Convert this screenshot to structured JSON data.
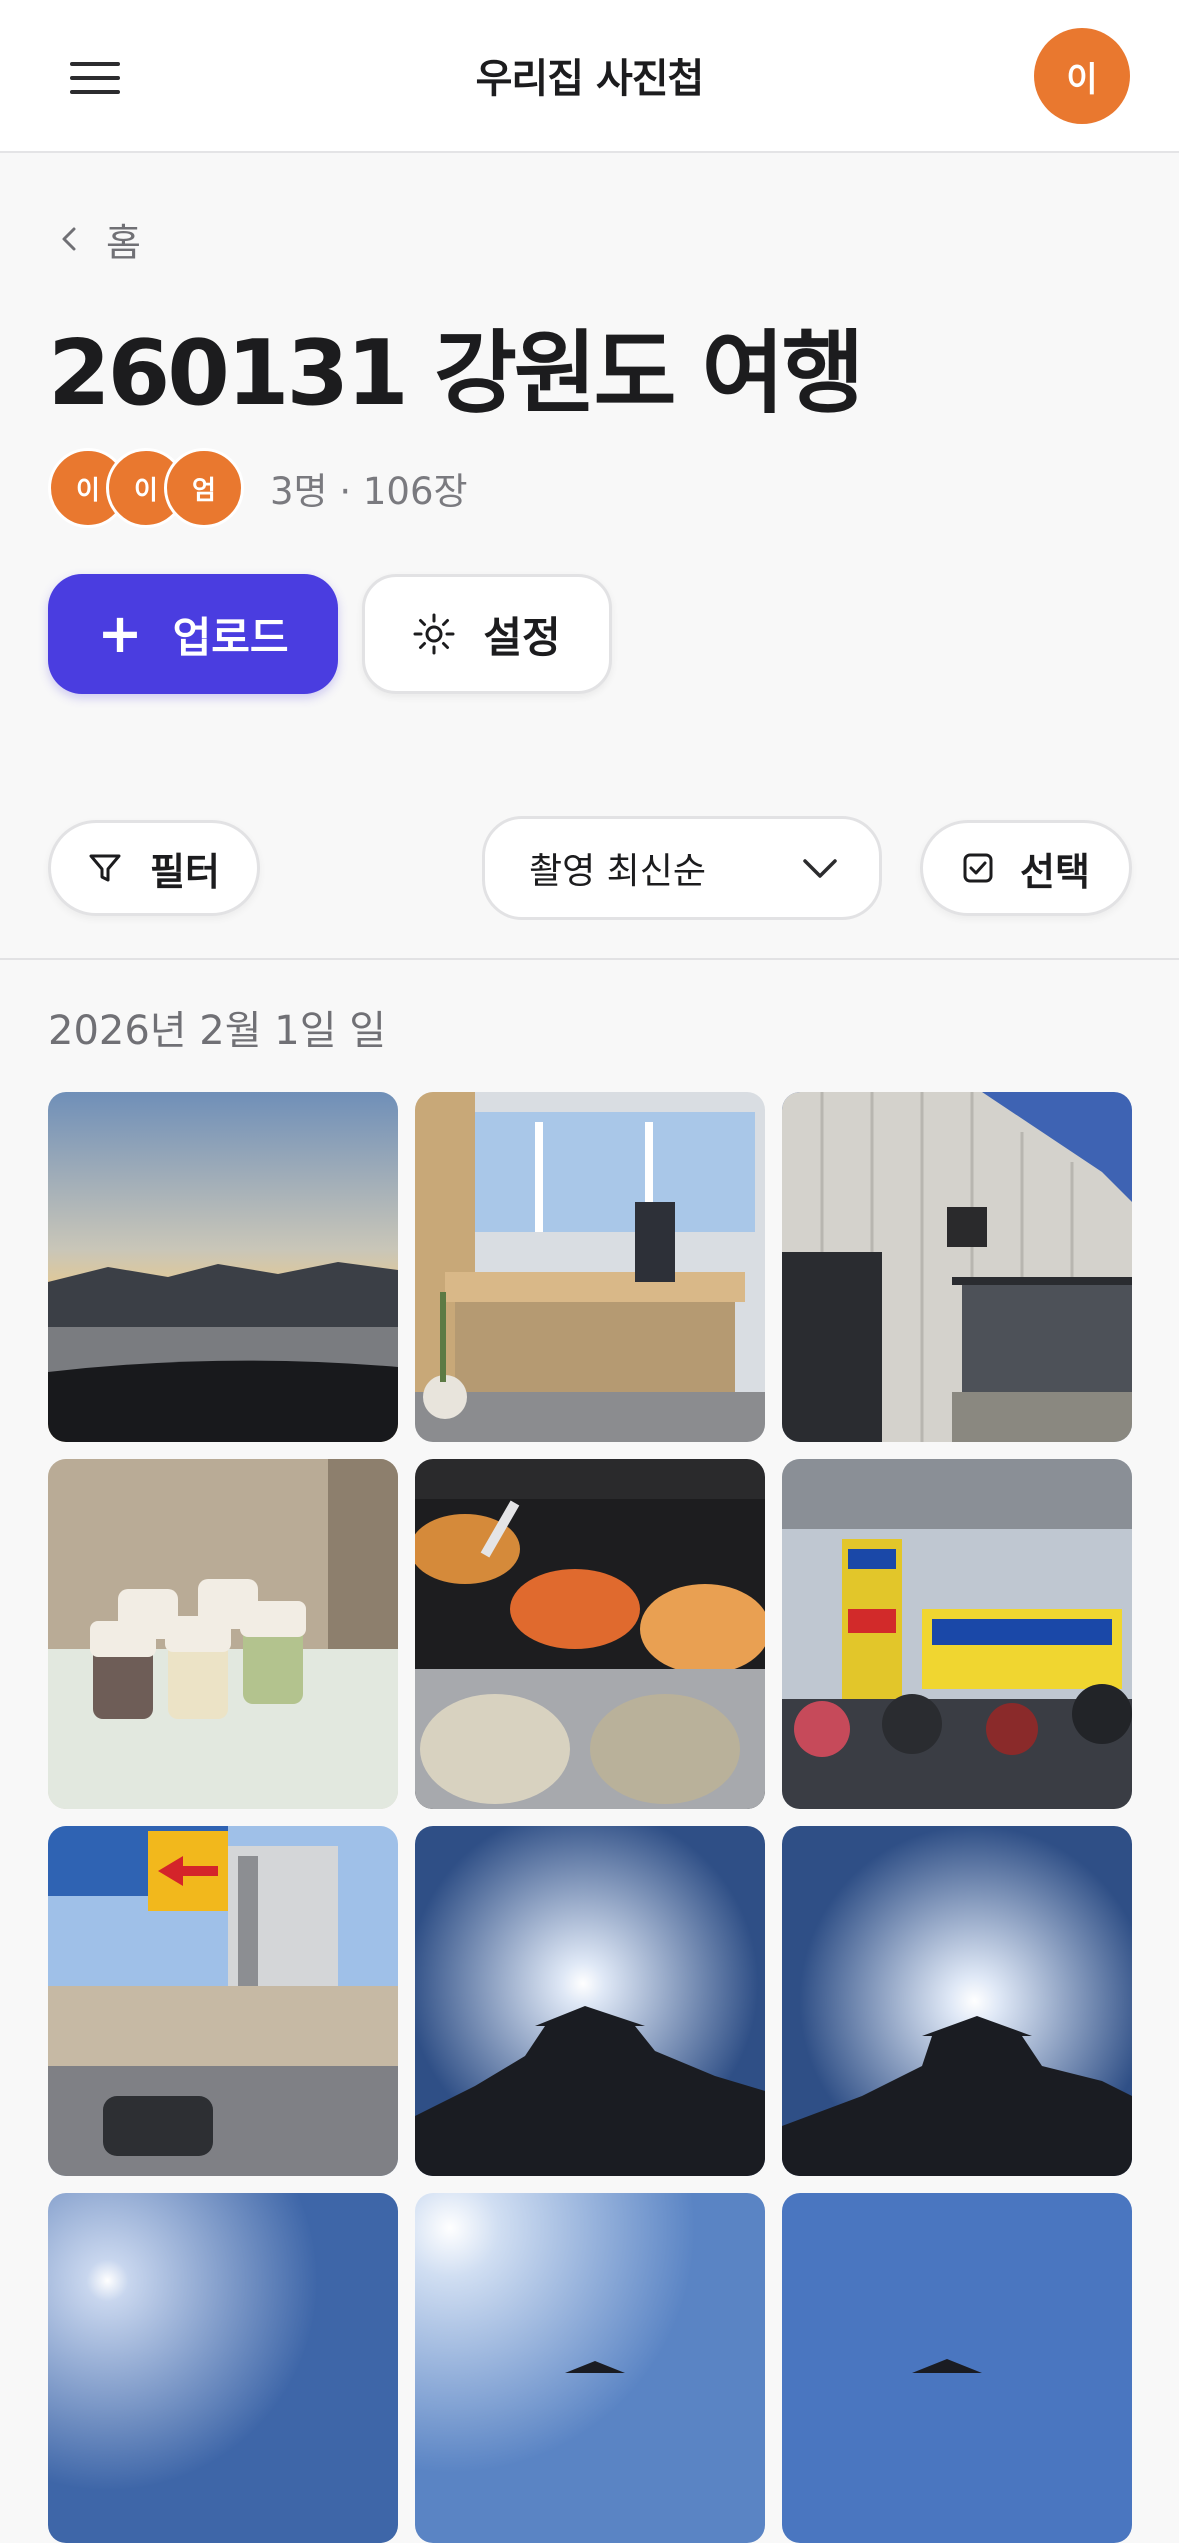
{
  "header": {
    "title": "우리집 사진첩",
    "user_initial": "이"
  },
  "breadcrumb": {
    "label": "홈"
  },
  "album": {
    "title": "260131 강원도 여행",
    "members": [
      "이",
      "이",
      "엄"
    ],
    "meta": "3명 · 106장"
  },
  "actions": {
    "upload_label": "업로드",
    "settings_label": "설정"
  },
  "toolbar": {
    "filter_label": "필터",
    "sort_value": "촬영 최신순",
    "select_label": "선택"
  },
  "date_group": {
    "label": "2026년 2월 1일 일"
  },
  "colors": {
    "accent": "#4a3de0",
    "avatar": "#e9782f"
  },
  "photos": [
    {
      "subject": "sunset-road"
    },
    {
      "subject": "cafe-interior"
    },
    {
      "subject": "building-exterior"
    },
    {
      "subject": "pudding-jars"
    },
    {
      "subject": "pancakes-grill"
    },
    {
      "subject": "market-stall"
    },
    {
      "subject": "street-scene"
    },
    {
      "subject": "pavilion-sun"
    },
    {
      "subject": "pavilion-sun-2"
    },
    {
      "subject": "sky-sun"
    },
    {
      "subject": "sky-pavilion"
    },
    {
      "subject": "sky-pavilion-2"
    }
  ]
}
